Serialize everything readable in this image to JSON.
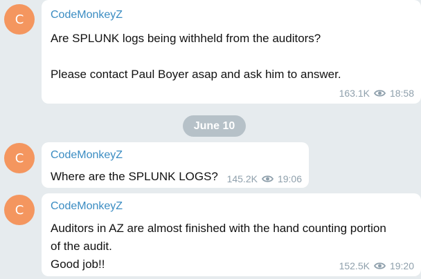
{
  "date_separator": "June 10",
  "messages": [
    {
      "avatar_letter": "C",
      "sender": "CodeMonkeyZ",
      "lines": [
        "Are SPLUNK logs being withheld from the auditors?",
        "",
        "Please contact Paul Boyer asap and ask him to answer."
      ],
      "views": "163.1K",
      "time": "18:58"
    },
    {
      "avatar_letter": "C",
      "sender": "CodeMonkeyZ",
      "lines": [
        "Where are the SPLUNK LOGS?"
      ],
      "views": "145.2K",
      "time": "19:06"
    },
    {
      "avatar_letter": "C",
      "sender": "CodeMonkeyZ",
      "lines": [
        "Auditors in AZ are almost finished with the hand counting portion",
        "of the audit.",
        "Good job!!"
      ],
      "views": "152.5K",
      "time": "19:20"
    }
  ],
  "colors": {
    "background": "#e6ebee",
    "avatar": "#f4965f",
    "sender": "#3a8cc2",
    "meta": "#8fa0ac",
    "date_pill": "#b6c1c8"
  },
  "icons": {
    "views": "eye-icon"
  }
}
